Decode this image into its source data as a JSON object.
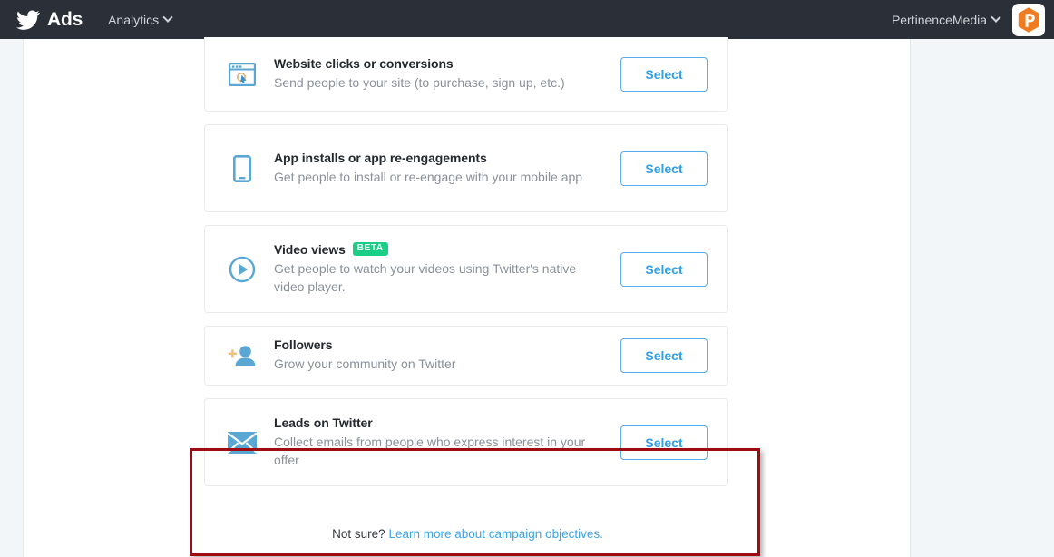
{
  "topbar": {
    "brand_label": "Ads",
    "bird_icon": "twitter-bird-icon",
    "nav_items": [
      {
        "label": "Analytics",
        "has_caret": true
      }
    ],
    "account_name": "PertinenceMedia",
    "avatar_icon": "pertinence-p-logo",
    "bg_color": "#2b3038"
  },
  "objectives": [
    {
      "icon": "browser-window-cursor-icon",
      "title": "Website clicks or conversions",
      "description": "Send people to your site (to purchase, sign up, etc.)",
      "badge": null,
      "select_label": "Select"
    },
    {
      "icon": "mobile-phone-icon",
      "title": "App installs or app re-engagements",
      "description": "Get people to install or re-engage with your mobile app",
      "badge": null,
      "select_label": "Select"
    },
    {
      "icon": "play-circle-icon",
      "title": "Video views",
      "description": "Get people to watch your videos using Twitter's native video player.",
      "badge": "BETA",
      "select_label": "Select"
    },
    {
      "icon": "add-follower-icon",
      "title": "Followers",
      "description": "Grow your community on Twitter",
      "badge": null,
      "select_label": "Select"
    },
    {
      "icon": "envelope-icon",
      "title": "Leads on Twitter",
      "description": "Collect emails from people who express interest in your offer",
      "badge": null,
      "select_label": "Select"
    }
  ],
  "footer": {
    "prefix": "Not sure?",
    "link_text": "Learn more about campaign objectives."
  },
  "annotation": {
    "type": "red-highlight-rectangle",
    "target": "Leads on Twitter",
    "color": "#9e0b10"
  },
  "colors": {
    "accent_blue": "#55acee",
    "icon_blue": "#5ba7d4",
    "badge_green": "#19cf86",
    "page_bg": "#f3f6f9",
    "muted_text": "#8a9199"
  }
}
